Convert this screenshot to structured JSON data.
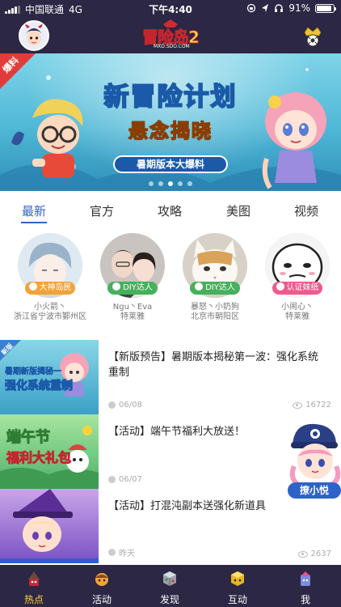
{
  "status_bar": {
    "carrier": "中国联通",
    "network": "4G",
    "time": "下午4:40",
    "battery": "91%",
    "battery_level": 0.91
  },
  "header": {
    "logo_text": "冒险岛2",
    "logo_subtext": "MXD.SDO.COM"
  },
  "banner": {
    "corner_tag": "爆料",
    "title": "新冒险计划",
    "subtitle": "悬念揭晓",
    "pill": "暑期版本大爆料",
    "slide_count": 5,
    "active_slide": 2
  },
  "tabs": [
    {
      "label": "最新",
      "active": true
    },
    {
      "label": "官方",
      "active": false
    },
    {
      "label": "攻略",
      "active": false
    },
    {
      "label": "美图",
      "active": false
    },
    {
      "label": "视频",
      "active": false
    }
  ],
  "users": [
    {
      "badge": "大神岛民",
      "badge_color": "#f3a23a",
      "name": "小火箭丶",
      "location": "浙江省宁波市鄞州区"
    },
    {
      "badge": "DIY达人",
      "badge_color": "#46b05c",
      "name": "Ngu丶Eva",
      "location": "特莱雅"
    },
    {
      "badge": "DIY达人",
      "badge_color": "#46b05c",
      "name": "暴怒丶小奶狗",
      "location": "北京市朝阳区"
    },
    {
      "badge": "认证妹纸",
      "badge_color": "#ef5a8c",
      "name": "小闹心丶",
      "location": "特莱雅"
    }
  ],
  "posts": [
    {
      "thumb_tag": "新版",
      "thumb_line1": "暑期新版揭秘一",
      "thumb_line2": "强化系统重制",
      "title": "【新版预告】暑期版本揭秘第一波：强化系统重制",
      "date": "06/08",
      "views": "16722"
    },
    {
      "thumb_line1": "端午节",
      "thumb_line2": "福利大礼包",
      "title": "【活动】端午节福利大放送！",
      "date": "06/07",
      "views": ""
    },
    {
      "title": "【活动】打混沌副本送强化新道具",
      "date": "昨天",
      "views": "2637"
    }
  ],
  "helper": {
    "label": "撩小悦"
  },
  "bottom_nav": [
    {
      "label": "热点",
      "active": true
    },
    {
      "label": "活动",
      "active": false
    },
    {
      "label": "发现",
      "active": false
    },
    {
      "label": "互动",
      "active": false
    },
    {
      "label": "我",
      "active": false
    }
  ],
  "colors": {
    "bar_bg": "#2b2744",
    "accent_blue": "#3361c8",
    "active_nav": "#ffd23c"
  }
}
